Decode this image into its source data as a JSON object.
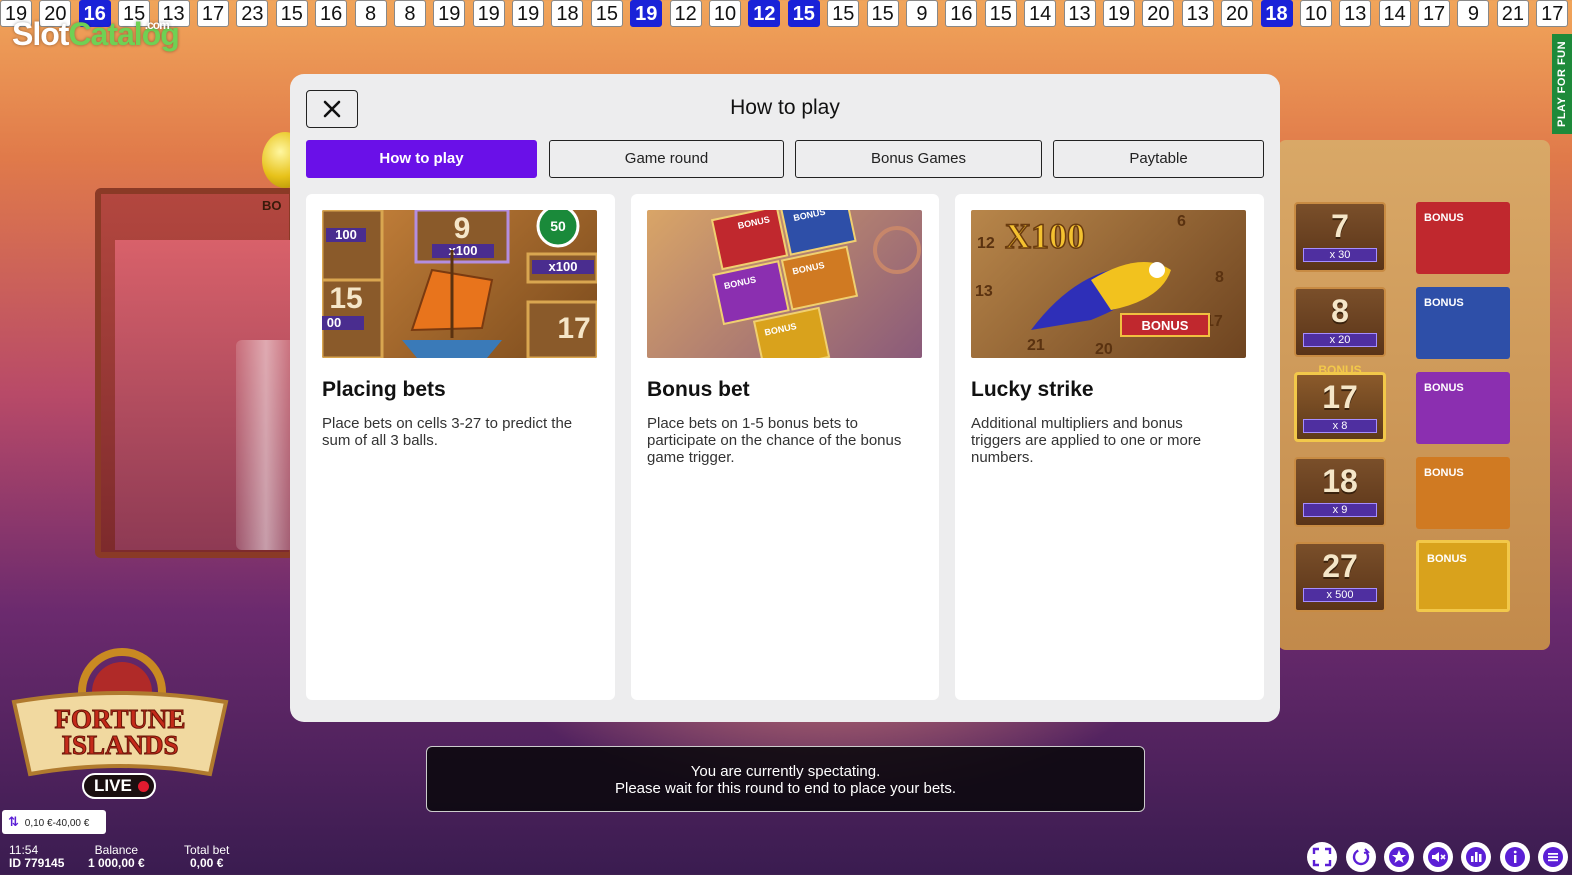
{
  "history": [
    {
      "v": "19",
      "hl": false
    },
    {
      "v": "20",
      "hl": false
    },
    {
      "v": "16",
      "hl": true
    },
    {
      "v": "15",
      "hl": false
    },
    {
      "v": "13",
      "hl": false
    },
    {
      "v": "17",
      "hl": false
    },
    {
      "v": "23",
      "hl": false
    },
    {
      "v": "15",
      "hl": false
    },
    {
      "v": "16",
      "hl": false
    },
    {
      "v": "8",
      "hl": false
    },
    {
      "v": "8",
      "hl": false
    },
    {
      "v": "19",
      "hl": false
    },
    {
      "v": "19",
      "hl": false
    },
    {
      "v": "19",
      "hl": false
    },
    {
      "v": "18",
      "hl": false
    },
    {
      "v": "15",
      "hl": false
    },
    {
      "v": "19",
      "hl": true
    },
    {
      "v": "12",
      "hl": false
    },
    {
      "v": "10",
      "hl": false
    },
    {
      "v": "12",
      "hl": true
    },
    {
      "v": "15",
      "hl": true
    },
    {
      "v": "15",
      "hl": false
    },
    {
      "v": "15",
      "hl": false
    },
    {
      "v": "9",
      "hl": false
    },
    {
      "v": "16",
      "hl": false
    },
    {
      "v": "15",
      "hl": false
    },
    {
      "v": "14",
      "hl": false
    },
    {
      "v": "13",
      "hl": false
    },
    {
      "v": "19",
      "hl": false
    },
    {
      "v": "20",
      "hl": false
    },
    {
      "v": "13",
      "hl": false
    },
    {
      "v": "20",
      "hl": false
    },
    {
      "v": "18",
      "hl": true
    },
    {
      "v": "10",
      "hl": false
    },
    {
      "v": "13",
      "hl": false
    },
    {
      "v": "14",
      "hl": false
    },
    {
      "v": "17",
      "hl": false
    },
    {
      "v": "9",
      "hl": false
    },
    {
      "v": "21",
      "hl": false
    },
    {
      "v": "17",
      "hl": false
    }
  ],
  "watermark": {
    "slot": "Slot",
    "catalog": "Catalog",
    "com": ".com"
  },
  "play_for_fun": "PLAY FOR FUN",
  "background": {
    "bo_text": "BO"
  },
  "board": {
    "numbers": [
      {
        "n": "7",
        "mult": "x 30",
        "gold": false,
        "top": ""
      },
      {
        "n": "8",
        "mult": "x 20",
        "gold": false,
        "top": ""
      },
      {
        "n": "17",
        "mult": "x 8",
        "gold": true,
        "top": "BONUS"
      },
      {
        "n": "18",
        "mult": "x 9",
        "gold": false,
        "top": ""
      },
      {
        "n": "27",
        "mult": "x 500",
        "gold": false,
        "top": ""
      }
    ],
    "bonus_tiles": [
      {
        "label": "BONUS",
        "color": "#c0282e"
      },
      {
        "label": "BONUS",
        "color": "#2e4fa8"
      },
      {
        "label": "BONUS",
        "color": "#8b2fb0"
      },
      {
        "label": "BONUS",
        "color": "#d07a22"
      },
      {
        "label": "BONUS",
        "color": "#d9a21c"
      }
    ]
  },
  "modal": {
    "title": "How to play",
    "close_icon": "close-icon",
    "tabs": [
      {
        "label": "How to play",
        "active": true
      },
      {
        "label": "Game round",
        "active": false
      },
      {
        "label": "Bonus Games",
        "active": false
      },
      {
        "label": "Paytable",
        "active": false
      }
    ],
    "cards": [
      {
        "title": "Placing bets",
        "desc": "Place bets on cells 3-27 to predict the sum of all 3 balls.",
        "img_labels": [
          "9",
          "x100",
          "100",
          "50",
          "15",
          "x100",
          "00",
          "17"
        ]
      },
      {
        "title": "Bonus bet",
        "desc": "Place bets on 1-5 bonus bets to participate on the chance of the bonus game trigger.",
        "img_labels": [
          "BONUS",
          "BONUS",
          "BONUS",
          "BONUS",
          "BONUS"
        ]
      },
      {
        "title": "Lucky strike",
        "desc": "Additional multipliers and bonus triggers are applied to one or more numbers.",
        "img_labels": [
          "X100",
          "BONUS",
          "12",
          "6",
          "8",
          "13",
          "17",
          "21",
          "20"
        ]
      }
    ]
  },
  "spectate": {
    "line1": "You are currently spectating.",
    "line2": "Please wait for this round to end to place your bets."
  },
  "logo": {
    "line1": "FORTUNE",
    "line2": "ISLANDS",
    "live": "LIVE"
  },
  "bet_range": "0,10 €-40,00 €",
  "footer": {
    "time": "11:54",
    "id": "ID 779145",
    "balance_label": "Balance",
    "balance_value": "1 000,00 €",
    "total_bet_label": "Total bet",
    "total_bet_value": "0,00 €"
  },
  "toolbar_icons": [
    {
      "name": "fullscreen-icon",
      "color": "#5b1fd6"
    },
    {
      "name": "refresh-icon",
      "color": "#5b1fd6"
    },
    {
      "name": "star-icon",
      "color": "#5b1fd6"
    },
    {
      "name": "sound-muted-icon",
      "color": "#5b1fd6"
    },
    {
      "name": "statistics-icon",
      "color": "#5b1fd6"
    },
    {
      "name": "info-icon",
      "color": "#5b1fd6"
    },
    {
      "name": "menu-icon",
      "color": "#5b1fd6"
    }
  ],
  "colors": {
    "accent": "#6a10e8",
    "history_highlight": "#1a22d8"
  }
}
